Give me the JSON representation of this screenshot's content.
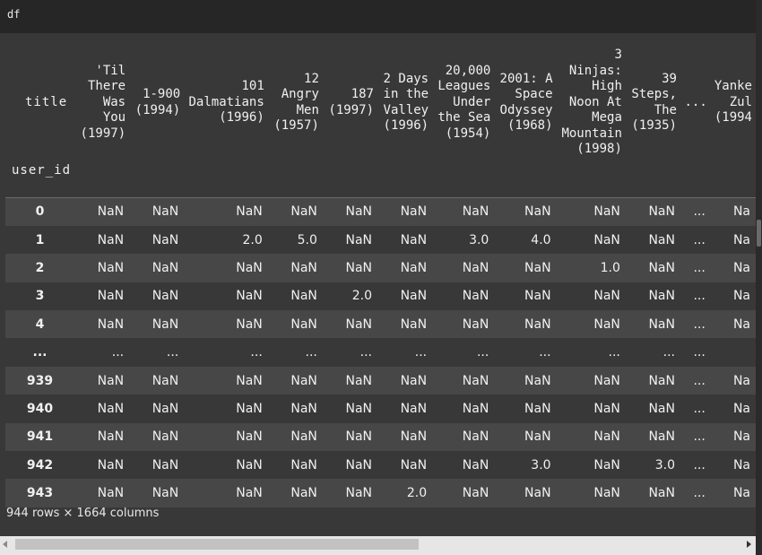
{
  "cell": {
    "code": "df"
  },
  "table": {
    "columns_name": "title",
    "index_name": "user_id",
    "columns": [
      [
        "'Til",
        "There",
        "Was",
        "You",
        "(1997)"
      ],
      [
        "1-900",
        "(1994)"
      ],
      [
        "101",
        "Dalmatians",
        "(1996)"
      ],
      [
        "12",
        "Angry",
        "Men",
        "(1957)"
      ],
      [
        "187",
        "(1997)"
      ],
      [
        "2 Days",
        "in the",
        "Valley",
        "(1996)"
      ],
      [
        "20,000",
        "Leagues",
        "Under",
        "the Sea",
        "(1954)"
      ],
      [
        "2001: A",
        "Space",
        "Odyssey",
        "(1968)"
      ],
      [
        "3",
        "Ninjas:",
        "High",
        "Noon At",
        "Mega",
        "Mountain",
        "(1998)"
      ],
      [
        "39",
        "Steps,",
        "The",
        "(1935)"
      ],
      [
        "..."
      ],
      [
        "Yanke",
        "Zul",
        "(1994"
      ]
    ],
    "rows": [
      {
        "index": "0",
        "values": [
          "NaN",
          "NaN",
          "NaN",
          "NaN",
          "NaN",
          "NaN",
          "NaN",
          "NaN",
          "NaN",
          "NaN",
          "...",
          "Na"
        ]
      },
      {
        "index": "1",
        "values": [
          "NaN",
          "NaN",
          "2.0",
          "5.0",
          "NaN",
          "NaN",
          "3.0",
          "4.0",
          "NaN",
          "NaN",
          "...",
          "Na"
        ]
      },
      {
        "index": "2",
        "values": [
          "NaN",
          "NaN",
          "NaN",
          "NaN",
          "NaN",
          "NaN",
          "NaN",
          "NaN",
          "1.0",
          "NaN",
          "...",
          "Na"
        ]
      },
      {
        "index": "3",
        "values": [
          "NaN",
          "NaN",
          "NaN",
          "NaN",
          "2.0",
          "NaN",
          "NaN",
          "NaN",
          "NaN",
          "NaN",
          "...",
          "Na"
        ]
      },
      {
        "index": "4",
        "values": [
          "NaN",
          "NaN",
          "NaN",
          "NaN",
          "NaN",
          "NaN",
          "NaN",
          "NaN",
          "NaN",
          "NaN",
          "...",
          "Na"
        ]
      },
      {
        "index": "...",
        "values": [
          "...",
          "...",
          "...",
          "...",
          "...",
          "...",
          "...",
          "...",
          "...",
          "...",
          "...",
          ""
        ]
      },
      {
        "index": "939",
        "values": [
          "NaN",
          "NaN",
          "NaN",
          "NaN",
          "NaN",
          "NaN",
          "NaN",
          "NaN",
          "NaN",
          "NaN",
          "...",
          "Na"
        ]
      },
      {
        "index": "940",
        "values": [
          "NaN",
          "NaN",
          "NaN",
          "NaN",
          "NaN",
          "NaN",
          "NaN",
          "NaN",
          "NaN",
          "NaN",
          "...",
          "Na"
        ]
      },
      {
        "index": "941",
        "values": [
          "NaN",
          "NaN",
          "NaN",
          "NaN",
          "NaN",
          "NaN",
          "NaN",
          "NaN",
          "NaN",
          "NaN",
          "...",
          "Na"
        ]
      },
      {
        "index": "942",
        "values": [
          "NaN",
          "NaN",
          "NaN",
          "NaN",
          "NaN",
          "NaN",
          "NaN",
          "3.0",
          "NaN",
          "3.0",
          "...",
          "Na"
        ]
      },
      {
        "index": "943",
        "values": [
          "NaN",
          "NaN",
          "NaN",
          "NaN",
          "NaN",
          "2.0",
          "NaN",
          "NaN",
          "NaN",
          "NaN",
          "...",
          "Na"
        ]
      }
    ],
    "shape_text": "944 rows × 1664 columns"
  },
  "scrollbars": {
    "horizontal": "horizontal-scrollbar",
    "vertical": "vertical-scrollbar"
  },
  "icons": {
    "left": "chevron-left-icon",
    "right": "chevron-right-icon"
  },
  "colors": {
    "background": "#383838",
    "row_alt": "#474747",
    "cell_bar": "#262626",
    "text": "#f0f0f0"
  }
}
